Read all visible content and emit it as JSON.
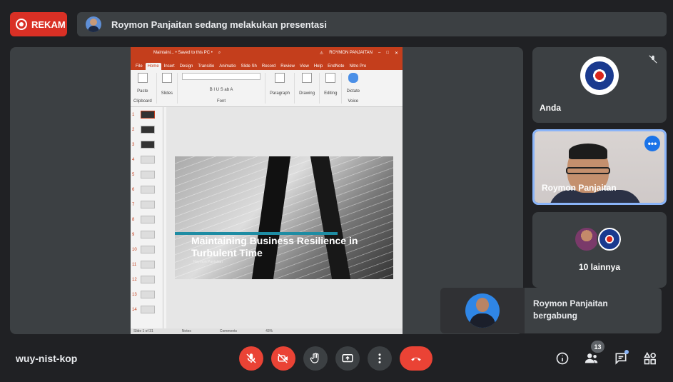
{
  "record": {
    "label": "REKAM"
  },
  "presenting": {
    "text": "Roymon Panjaitan sedang melakukan presentasi"
  },
  "ppt": {
    "title": "Maintaini... • Saved to this PC •",
    "user": "ROYMON PANJAITAN",
    "tabs": [
      "File",
      "Home",
      "Insert",
      "Design",
      "Transitio",
      "Animatio",
      "Slide Sh",
      "Record",
      "Review",
      "View",
      "Help",
      "EndNote",
      "Nitro Pro"
    ],
    "ribbon": {
      "paste": "Paste",
      "clipboard": "Clipboard",
      "slides": "Slides",
      "font": "Font",
      "paragraph": "Paragraph",
      "drawing": "Drawing",
      "editing": "Editing",
      "dictate": "Dictate",
      "voice": "Voice"
    },
    "thumbnails": [
      "1",
      "2",
      "3",
      "4",
      "5",
      "6",
      "7",
      "8",
      "9",
      "10",
      "11",
      "12",
      "13",
      "14"
    ],
    "slide": {
      "title": "Maintaining Business Resilience in Turbulent Time",
      "subtitle": "Roymon Panjaitan"
    },
    "status": {
      "slide_info": "Slide 1 of 31",
      "notes": "Notes",
      "comments": "Comments",
      "zoom": "43%"
    }
  },
  "tiles": {
    "you": {
      "name": "Anda",
      "icon": "mic-off-icon"
    },
    "speaker": {
      "name": "Roymon Panjaitan"
    },
    "others": {
      "label": "10 lainnya"
    }
  },
  "join": {
    "text": "Roymon Panjaitan bergabung"
  },
  "meeting": {
    "code": "wuy-nist-kop"
  },
  "people_count": "13",
  "colors": {
    "accent": "#8ab4f8",
    "danger": "#ea4335",
    "surface": "#3c4043",
    "background": "#202124",
    "ppt": "#c43e1c"
  }
}
